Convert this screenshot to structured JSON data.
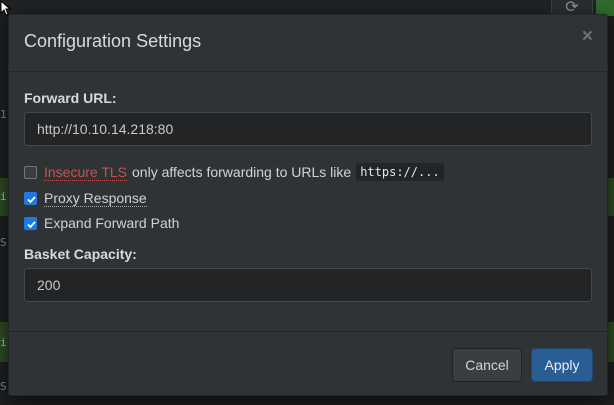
{
  "modal": {
    "title": "Configuration Settings",
    "close_symbol": "×",
    "forward_url": {
      "label": "Forward URL:",
      "value": "http://10.10.14.218:80"
    },
    "insecure_tls": {
      "link_text": "Insecure TLS",
      "description": "only affects forwarding to URLs like",
      "code": "https://...",
      "checked": false
    },
    "proxy_response": {
      "label": "Proxy Response",
      "checked": true
    },
    "expand_forward_path": {
      "label": "Expand Forward Path",
      "checked": true
    },
    "basket_capacity": {
      "label": "Basket Capacity:",
      "value": "200"
    },
    "buttons": {
      "cancel": "Cancel",
      "apply": "Apply"
    }
  },
  "background": {
    "refresh_icon": "refresh-icon",
    "marks": [
      "1",
      "i",
      "S",
      "i",
      "S"
    ]
  },
  "colors": {
    "modal_bg": "#303335",
    "accent_checkbox": "#1f7ae0",
    "apply_button": "#2a5d93",
    "warning_text": "#c8504a"
  }
}
